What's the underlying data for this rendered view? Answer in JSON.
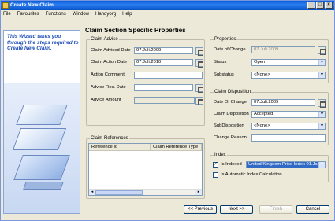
{
  "window": {
    "title": "Create New Claim",
    "controls": [
      "_",
      "□",
      "×"
    ]
  },
  "menu": [
    "File",
    "Favourites",
    "Functions",
    "Window",
    "Handyorg",
    "Help"
  ],
  "sidebar": {
    "text": "This Wizard takes you through the steps required to Create New Claim."
  },
  "section_title": "Claim Section Specific Properties",
  "claim_advise": {
    "title": "Claim Advise",
    "advised_date_label": "Claim Advised Date",
    "advised_date_value": "07.Juli.2009",
    "action_date_label": "Claim Action Date",
    "action_date_value": "07.Juli.2010",
    "action_comment_label": "Action Comment",
    "advice_rec_date_label": "Advice Rec. Date",
    "advice_amount_label": "Advice Amount"
  },
  "claim_references": {
    "title": "Claim References",
    "columns": [
      "Reference Id",
      "Claim Reference Type"
    ]
  },
  "properties": {
    "title": "Properties",
    "date_of_change_label": "Date of Change",
    "date_of_change_value": "07.Juli.2009",
    "status_label": "Status",
    "status_value": "Open",
    "substatus_label": "Substatus",
    "substatus_value": "<None>"
  },
  "claim_disposition": {
    "title": "Claim Disposition",
    "date_of_change_label": "Date Of Change",
    "date_of_change_value": "07.Juli.2009",
    "disposition_label": "Claim Disposition",
    "disposition_value": "Accepted",
    "subdisposition_label": "SubDisposition",
    "subdisposition_value": "<None>",
    "change_reason_label": "Change Reason"
  },
  "index": {
    "title": "Index",
    "is_indexed_label": "Is Indexed",
    "is_indexed_checked": true,
    "index_value": "United Kingdom Price Index 01.Jan",
    "auto_calc_label": "Is Automatic Index Calculation",
    "auto_calc_checked": false
  },
  "buttons": {
    "previous": "<< Previous",
    "next": "Next >>",
    "finish": "Finish",
    "cancel": "Cancel"
  }
}
